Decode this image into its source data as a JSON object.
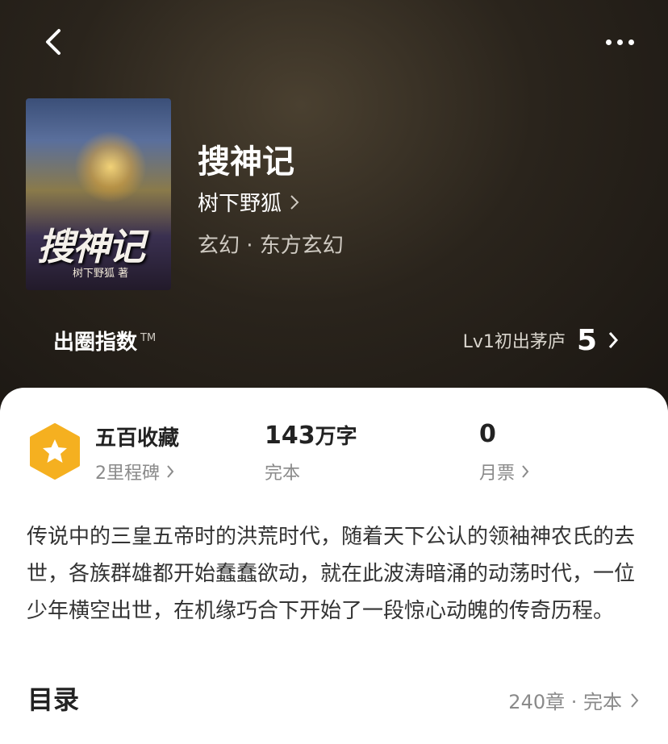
{
  "nav": {
    "back_icon": "chevron-left-icon",
    "more_icon": "more-dots-icon"
  },
  "book": {
    "cover_title": "搜神记",
    "cover_author": "树下野狐 著",
    "title": "搜神记",
    "author": "树下野狐",
    "category": "玄幻 · 东方玄幻"
  },
  "index": {
    "label": "出圈指数",
    "tm": "TM",
    "level": "Lv1初出茅庐",
    "value": "5"
  },
  "stats": {
    "collect_title": "五百收藏",
    "collect_sub": "2里程碑",
    "words_num": "143",
    "words_unit": "万字",
    "words_sub": "完本",
    "tickets": "0",
    "tickets_sub": "月票"
  },
  "synopsis": "传说中的三皇五帝时的洪荒时代，随着天下公认的领袖神农氏的去世，各族群雄都开始蠢蠢欲动，就在此波涛暗涌的动荡时代，一位少年横空出世，在机缘巧合下开始了一段惊心动魄的传奇历程。",
  "toc": {
    "title": "目录",
    "meta": "240章 · 完本"
  },
  "colors": {
    "badge": "#f5b020",
    "hero_bg": "#231e18"
  }
}
